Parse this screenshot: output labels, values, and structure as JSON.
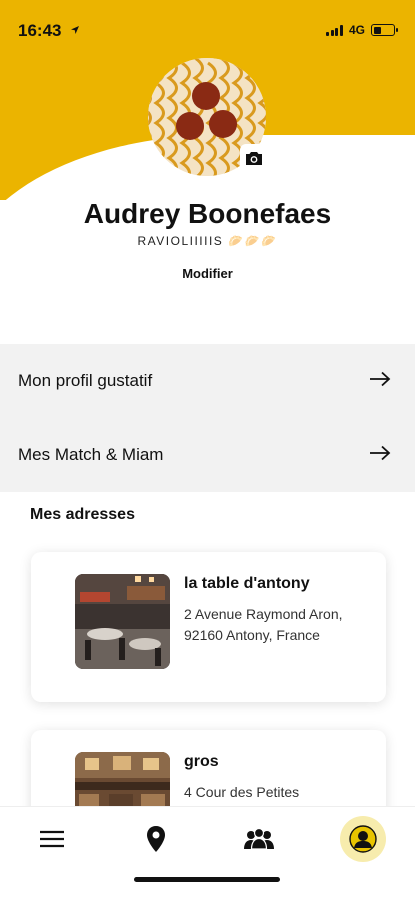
{
  "status_bar": {
    "time": "16:43",
    "network": "4G",
    "location_icon": "location-arrow-icon"
  },
  "colors": {
    "accent_yellow": "#ebb400",
    "menu_background": "#f2f2f2",
    "profile_tab_highlight": "#f7ecad"
  },
  "profile": {
    "name": "Audrey Boonefaes",
    "bio": "RAVIOLIIIIIS 🥟🥟🥟",
    "edit_label": "Modifier",
    "camera_icon": "camera-icon"
  },
  "menu": {
    "items": [
      {
        "label": "Mon profil gustatif",
        "icon": "arrow-right-icon"
      },
      {
        "label": "Mes Match & Miam",
        "icon": "arrow-right-icon"
      }
    ]
  },
  "addresses": {
    "title": "Mes adresses",
    "cards": [
      {
        "name": "la table d'antony",
        "address": "2 Avenue Raymond Aron, 92160 Antony, France"
      },
      {
        "name": "gros",
        "address": "4 Cour des Petites"
      }
    ]
  },
  "bottom_nav": {
    "items": [
      {
        "icon": "hamburger-menu-icon"
      },
      {
        "icon": "map-pin-icon"
      },
      {
        "icon": "group-icon"
      },
      {
        "icon": "user-profile-icon",
        "active": true
      }
    ]
  }
}
